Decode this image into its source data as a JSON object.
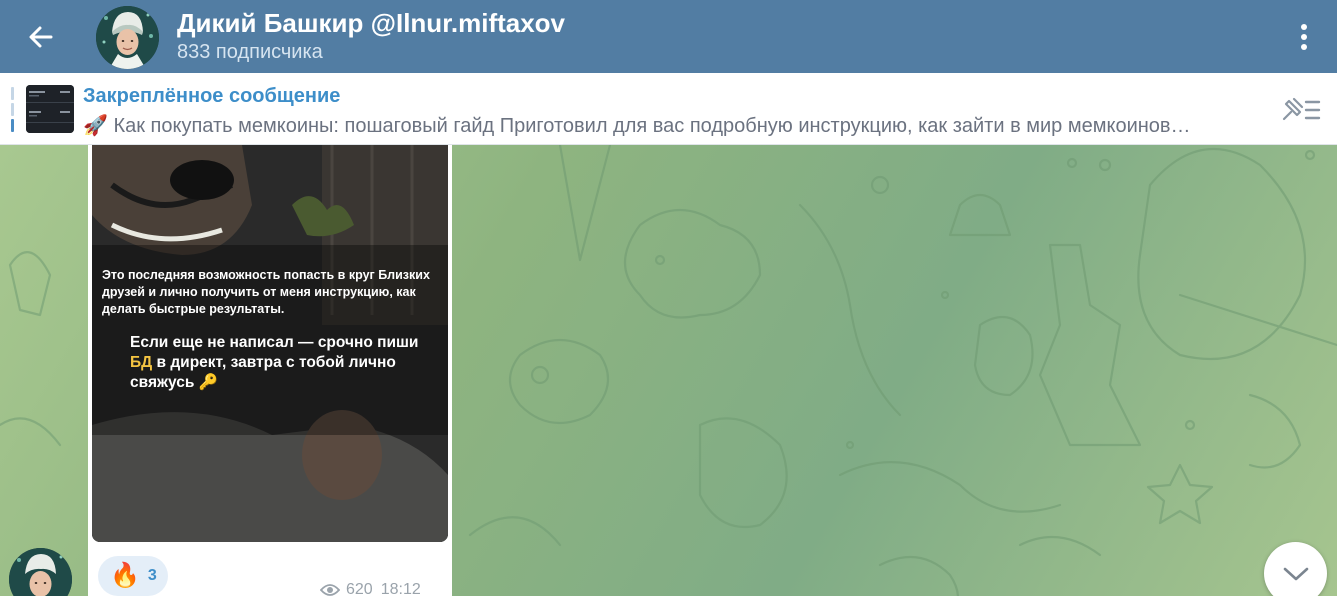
{
  "header": {
    "title": "Дикий Башкир @Ilnur.miftaxov",
    "subtitle": "833 подписчика",
    "back_icon": "arrow-left-icon",
    "menu_icon": "more-vertical-icon",
    "background_color": "#527da3"
  },
  "pinned": {
    "title": "Закреплённое сообщение",
    "text": "🚀 Как покупать мемкоины: пошаговый гайд  Приготовил для вас подробную инструкцию, как зайти в мир мемкоинов…",
    "list_icon": "pin-list-icon",
    "accent_color": "#3d8ec9"
  },
  "message": {
    "media_text_1": "Это последняя возможность попасть в круг Близких друзей и лично получить от меня инструкцию, как делать быстрые результаты.",
    "media_text_2_before": "Если еще не написал — срочно пиши ",
    "media_text_2_highlight": "БД",
    "media_text_2_after": " в директ, завтра с тобой лично свяжусь 🔑",
    "reaction": {
      "emoji": "🔥",
      "count": "3"
    },
    "views": "620",
    "time": "18:12"
  },
  "scroll_down_icon": "chevron-down-icon"
}
